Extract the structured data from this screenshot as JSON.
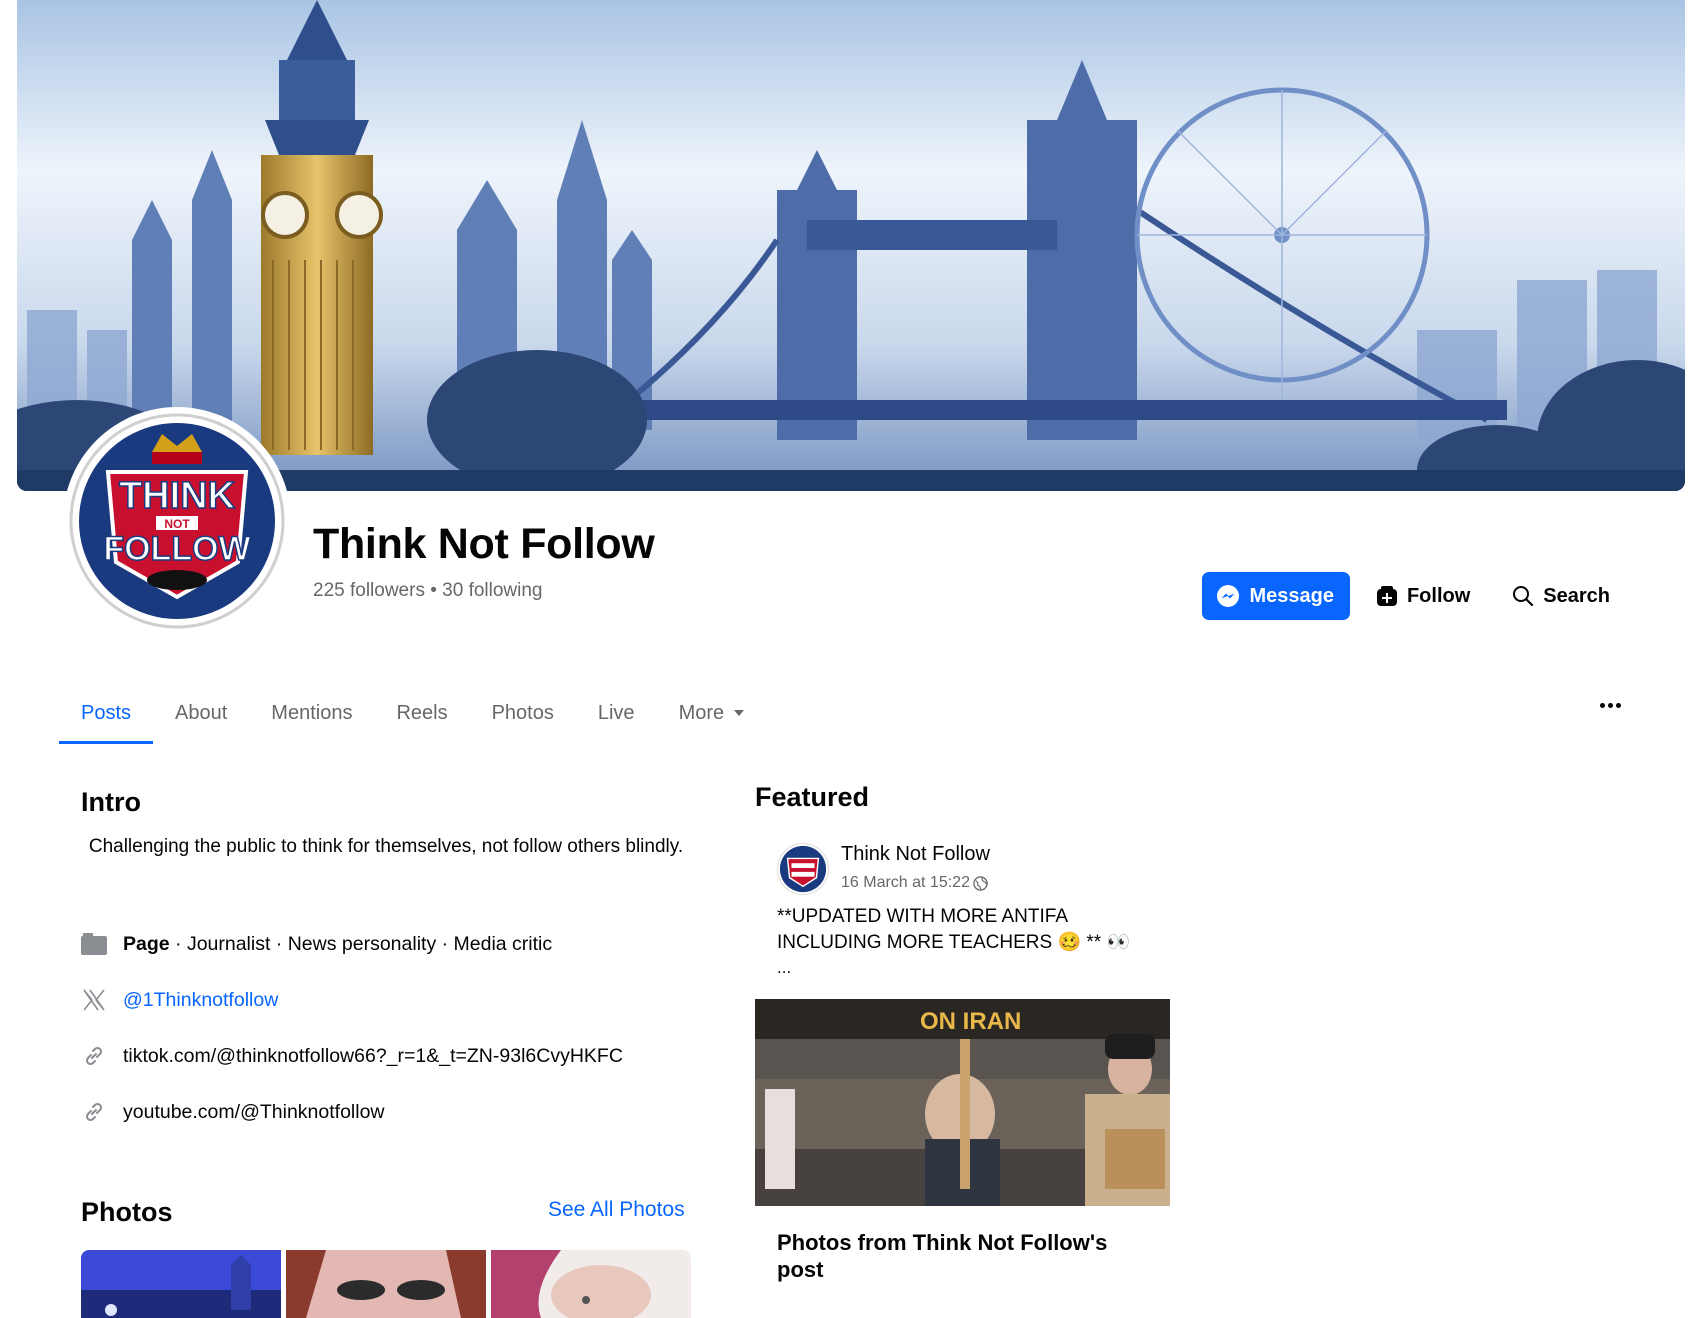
{
  "page": {
    "name": "Think Not Follow",
    "stats": "225 followers • 30 following",
    "logo_text": {
      "top": "THINK",
      "middle": "NOT",
      "bottom": "FOLLOW"
    }
  },
  "actions": {
    "message": "Message",
    "follow": "Follow",
    "search": "Search"
  },
  "tabs": [
    {
      "label": "Posts",
      "active": true
    },
    {
      "label": "About"
    },
    {
      "label": "Mentions"
    },
    {
      "label": "Reels"
    },
    {
      "label": "Photos"
    },
    {
      "label": "Live"
    },
    {
      "label": "More"
    }
  ],
  "intro": {
    "title": "Intro",
    "bio": "Challenging the public to think for themselves, not follow others blindly.",
    "category_label": "Page",
    "category_rest": " · Journalist · News personality · Media critic",
    "twitter": "@1Thinknotfollow",
    "tiktok": "tiktok.com/@thinknotfollow66?_r=1&_t=ZN-93l6CvyHKFC",
    "youtube": "youtube.com/@Thinknotfollow"
  },
  "photos": {
    "title": "Photos",
    "see_all": "See All Photos"
  },
  "featured": {
    "title": "Featured",
    "author": "Think Not Follow",
    "time": "16 March at 15:22",
    "text": "**UPDATED WITH MORE ANTIFA INCLUDING MORE TEACHERS 🥴 ** 👀",
    "ellipsis": "...",
    "image_sign_text": "ON IRAN",
    "caption": "Photos from Think Not Follow's post"
  },
  "colors": {
    "accent": "#0866ff",
    "secondary_text": "#65676b"
  }
}
